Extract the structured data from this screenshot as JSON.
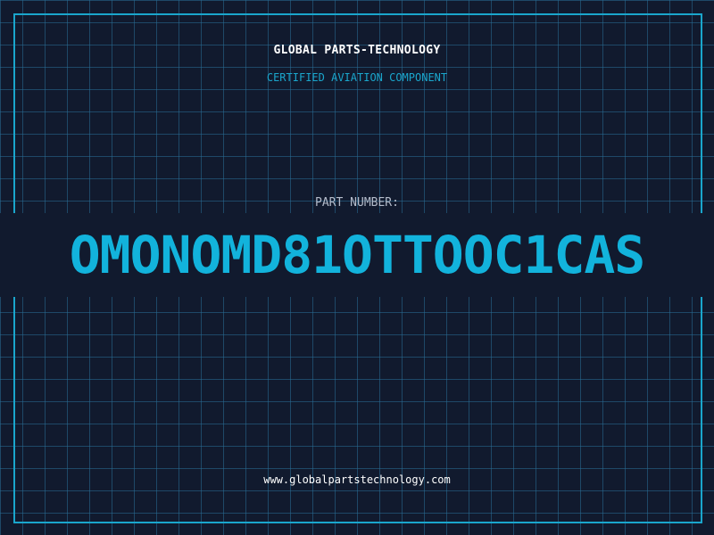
{
  "header": {
    "brand": "GLOBAL PARTS-TECHNOLOGY",
    "subtitle": "CERTIFIED AVIATION COMPONENT"
  },
  "part": {
    "label": "PART NUMBER:",
    "number": "OMONOMD81OTTOOC1CAS"
  },
  "footer": {
    "url": "www.globalpartstechnology.com"
  },
  "colors": {
    "background": "#111a2e",
    "grid": "#286e96",
    "accent": "#1aa6cc",
    "part_number": "#12b3dc",
    "label": "#b4bccb",
    "text": "#ffffff"
  }
}
